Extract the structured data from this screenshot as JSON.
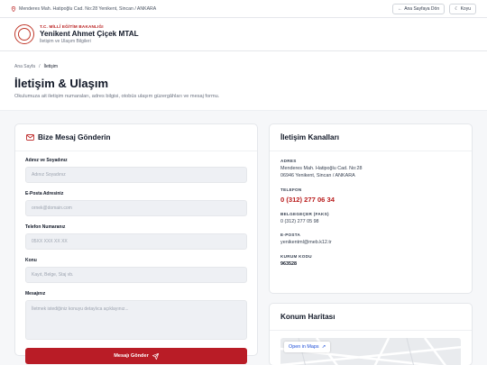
{
  "topbar": {
    "address": "Menderes Mah. Hatipoğlu Cad. No:28 Yenikent, Sincan / ANKARA",
    "home_label": "Ana Sayfaya Dön",
    "theme_label": "Koyu"
  },
  "header": {
    "ministry": "T.C. MİLLÎ EĞİTİM BAKANLIĞI",
    "school": "Yenikent Ahmet Çiçek MTAL",
    "subtitle": "İletişim ve Ulaşım Bilgileri"
  },
  "hero": {
    "crumb_home": "Ana Sayfa",
    "crumb_sep": "/",
    "crumb_current": "İletişim",
    "title": "İletişim & Ulaşım",
    "desc": "Okulumuza ait iletişim numaraları, adres bilgisi, otobüs ulaşım güzergâhları ve mesaj formu."
  },
  "form": {
    "title": "Bize Mesaj Gönderin",
    "name_label": "Adınız ve Soyadınız",
    "name_ph": "Adınız Soyadınız",
    "email_label": "E-Posta Adresiniz",
    "email_ph": "ornek@domain.com",
    "phone_label": "Telefon Numaranız",
    "phone_ph": "05XX XXX XX XX",
    "subject_label": "Konu",
    "subject_ph": "Kayıt, Belge, Staj vb.",
    "message_label": "Mesajınız",
    "message_ph": "İletmek istediğiniz konuyu detaylıca açıklayınız...",
    "submit": "Mesajı Gönder"
  },
  "channels": {
    "title": "İletişim Kanalları",
    "addr_label": "ADRES",
    "addr_line1": "Menderes Mah. Hatipoğlu Cad. No:28",
    "addr_line2": "06946 Yenikent, Sincan / ANKARA",
    "phone_label": "TELEFON",
    "phone": "0 (312) 277 06 34",
    "fax_label": "BELGEGEÇER (FAKS)",
    "fax": "0 (312) 277 05 98",
    "email_label": "E-POSTA",
    "email": "yenikentml@meb.k12.tr",
    "code_label": "KURUM KODU",
    "code": "963528"
  },
  "map": {
    "title": "Konum Haritası",
    "open_label": "Open in Maps"
  },
  "colors": {
    "accent": "#b91c26",
    "phone": "#b91c1c",
    "link": "#1d4ed8"
  }
}
